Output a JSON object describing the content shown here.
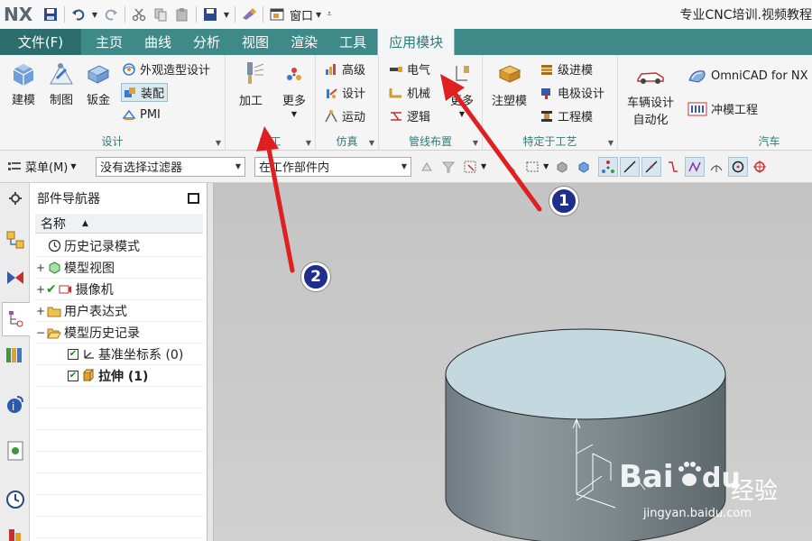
{
  "title_bar": {
    "logo": "NX",
    "window_menu": "窗口",
    "app_title": "专业CNC培训.视频教程"
  },
  "tabs": {
    "file": "文件(F)",
    "items": [
      "主页",
      "曲线",
      "分析",
      "视图",
      "渲染",
      "工具",
      "应用模块"
    ],
    "active": "应用模块"
  },
  "ribbon": {
    "design": {
      "label": "设计",
      "modeling": "建模",
      "drafting": "制图",
      "sheet_metal": "钣金",
      "shape_studio": "外观造型设计",
      "assembly": "装配",
      "pmi": "PMI"
    },
    "machining": {
      "label": "加工",
      "machining_btn": "加工",
      "more": "更多"
    },
    "simulation": {
      "label": "仿真",
      "advanced": "高级",
      "design": "设计",
      "motion": "运动"
    },
    "routing": {
      "label": "管线布置",
      "electrical": "电气",
      "mechanical": "机械",
      "logical": "逻辑",
      "more": "更多"
    },
    "process": {
      "label": "特定于工艺",
      "mold": "注塑模",
      "progressive_die": "级进模",
      "electrode": "电极设计",
      "engineering_die": "工程模"
    },
    "automotive": {
      "label": "汽车",
      "vehicle_design_line1": "车辆设计",
      "vehicle_design_line2": "自动化",
      "omnicad": "OmniCAD for NX",
      "stamping": "冲模工程"
    }
  },
  "selection_bar": {
    "menu": "菜单(M)",
    "filter": "没有选择过滤器",
    "scope": "在工作部件内"
  },
  "navigator": {
    "title": "部件导航器",
    "column": "名称",
    "rows": [
      {
        "label": "历史记录模式"
      },
      {
        "label": "模型视图"
      },
      {
        "label": "摄像机"
      },
      {
        "label": "用户表达式"
      },
      {
        "label": "模型历史记录"
      },
      {
        "label": "基准坐标系 (0)"
      },
      {
        "label": "拉伸 (1)"
      }
    ]
  },
  "annotations": {
    "badge1": "1",
    "badge2": "2"
  },
  "watermark": {
    "brand": "Bai",
    "brand2": "du",
    "cn": "经验",
    "url": "jingyan.baidu.com"
  },
  "colors": {
    "tab_bar": "#3d8a89",
    "file_tab": "#2b6e6d",
    "accent_text": "#2b7c7a",
    "arrow": "#e02020",
    "badge": "#1f2e8c"
  }
}
